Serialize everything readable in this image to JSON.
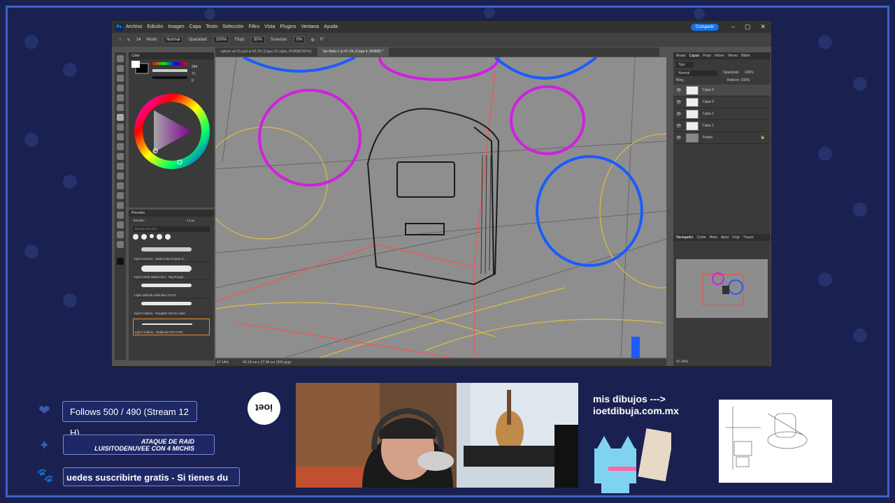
{
  "photoshop": {
    "menu": [
      "Archivo",
      "Edición",
      "Imagen",
      "Capa",
      "Texto",
      "Selección",
      "Filtro",
      "Vista",
      "Plugins",
      "Ventana",
      "Ayuda"
    ],
    "window_controls": [
      "–",
      "▢",
      "✕"
    ],
    "options": {
      "mode_label": "Modo:",
      "mode_value": "Normal",
      "opacity_label": "Opacidad:",
      "opacity_value": "100%",
      "flow_label": "Flujo:",
      "flow_value": "50%",
      "smooth_label": "Suavizar:",
      "smooth_value": "0%",
      "angle_value": "0°",
      "brush_size": "14"
    },
    "share_label": "Compartir",
    "tabs": [
      {
        "label": "splash art 01.psd al 52.3% (Capa 15 copia, RGB/8/CMYK)",
        "active": false
      },
      {
        "label": "Sin título-1 al 47.1% (Capa 4, RGB/8) *",
        "active": true
      }
    ],
    "color_panel": {
      "title": "Color",
      "h_value": "284",
      "s_value": "71",
      "b_value": "0"
    },
    "brushes_panel": {
      "title": "Pinceles",
      "size_label": "Tamaño:",
      "size_value": "14 px",
      "search_placeholder": "Buscar pinceles",
      "brushes": [
        {
          "name": "Kyle's Eraser - Watercolor Eraser E...",
          "selected": false
        },
        {
          "name": "Kyle's Real Watercolor - Big Rough...",
          "selected": false
        },
        {
          "name": "Lápiz definido definitivo KYLE",
          "selected": false
        },
        {
          "name": "Kyle's Inkbox - Rougher Ink No Alias",
          "selected": false
        },
        {
          "name": "Kyle's Inkbox - Ballpoint Pen KTW",
          "selected": true
        }
      ]
    },
    "status": {
      "zoom": "47.14%",
      "dimensions": "43.18 cm x 27.94 cm (300 ppp)"
    },
    "right_tabs": [
      "Muest",
      "Capas",
      "Propi",
      "Inform",
      "Herrar",
      "Biblot"
    ],
    "active_right_tab": "Capas",
    "layers_filter": "Tipo",
    "blend_mode": "Normal",
    "opacity_label": "Opacidad:",
    "opacity_value": "100%",
    "lock_label": "Bloq.:",
    "fill_label": "Relleno:",
    "fill_value": "100%",
    "layers": [
      {
        "name": "Capa 4",
        "selected": true
      },
      {
        "name": "Capa 3",
        "selected": false
      },
      {
        "name": "Capa 2",
        "selected": false
      },
      {
        "name": "Capa 1",
        "selected": false
      },
      {
        "name": "Fondo",
        "selected": false
      }
    ],
    "nav_tabs": [
      "Navegador",
      "Coste",
      "Histo",
      "Ajust",
      "Origi",
      "Trazos"
    ],
    "nav_zoom": "47.14%"
  },
  "overlay": {
    "follows": "Follows 500 / 490 (Stream 12 H)",
    "raid_line1": "ATAQUE DE RAID",
    "raid_line2": "LUISITODENUVEE CON 4 MICHIS",
    "ticker": "uedes suscribirte gratis - Si tienes du",
    "badge": "ioet",
    "promo_line1": "mis dibujos --->",
    "promo_line2": "ioetdibuja.com.mx"
  }
}
